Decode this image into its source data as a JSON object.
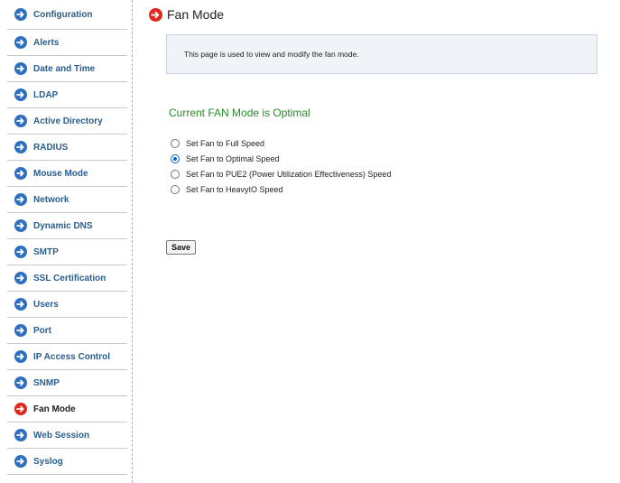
{
  "sidebar": {
    "items": [
      {
        "label": "Configuration",
        "active": false
      },
      {
        "label": "Alerts",
        "active": false
      },
      {
        "label": "Date and Time",
        "active": false
      },
      {
        "label": "LDAP",
        "active": false
      },
      {
        "label": "Active Directory",
        "active": false
      },
      {
        "label": "RADIUS",
        "active": false
      },
      {
        "label": "Mouse Mode",
        "active": false
      },
      {
        "label": "Network",
        "active": false
      },
      {
        "label": "Dynamic DNS",
        "active": false
      },
      {
        "label": "SMTP",
        "active": false
      },
      {
        "label": "SSL Certification",
        "active": false
      },
      {
        "label": "Users",
        "active": false
      },
      {
        "label": "Port",
        "active": false
      },
      {
        "label": "IP Access Control",
        "active": false
      },
      {
        "label": "SNMP",
        "active": false
      },
      {
        "label": "Fan Mode",
        "active": true
      },
      {
        "label": "Web Session",
        "active": false
      },
      {
        "label": "Syslog",
        "active": false
      }
    ],
    "icon": "arrow-circle-right-icon",
    "icon_color": "#2f6fbf",
    "active_icon_color": "#e0281c"
  },
  "main": {
    "title": "Fan Mode",
    "info_text": "This page is used to view and modify the fan mode.",
    "current_mode_text": "Current FAN Mode is Optimal",
    "options": [
      {
        "label": "Set Fan to Full Speed",
        "checked": false
      },
      {
        "label": "Set Fan to Optimal Speed",
        "checked": true
      },
      {
        "label": "Set Fan to PUE2 (Power Utilization Effectiveness) Speed",
        "checked": false
      },
      {
        "label": "Set Fan to HeavyIO Speed",
        "checked": false
      }
    ],
    "save_label": "Save"
  }
}
